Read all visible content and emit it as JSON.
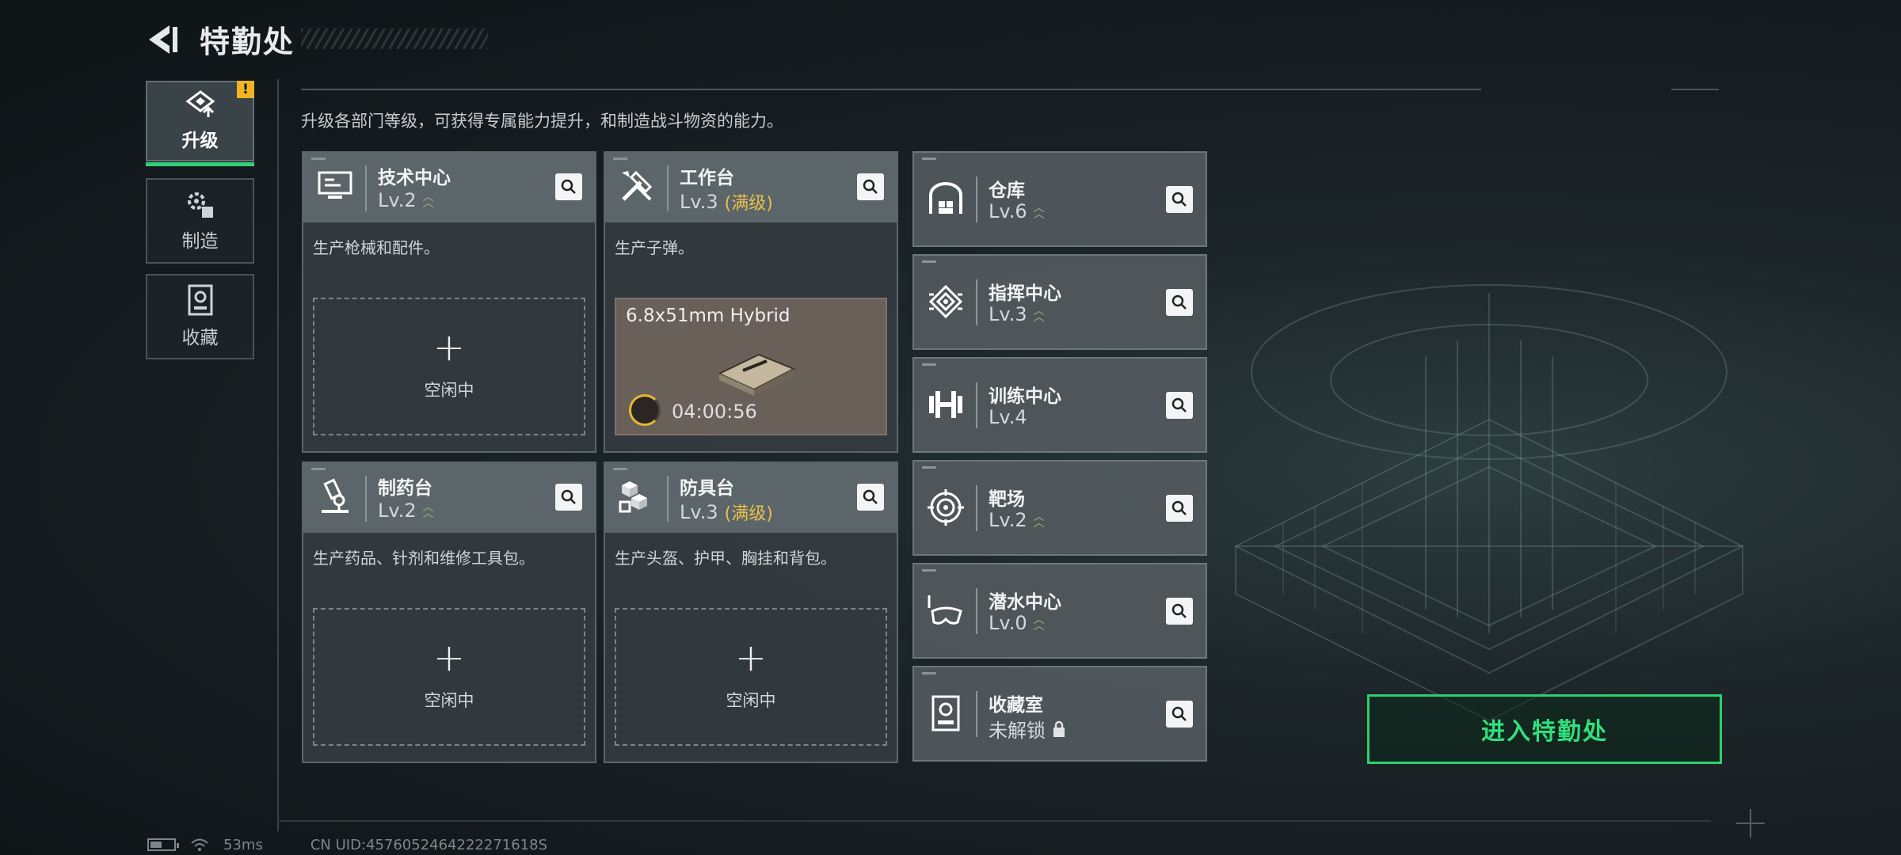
{
  "header": {
    "title": "特勤处"
  },
  "nav": {
    "upgrade_label": "升级",
    "upgrade_badge": "!",
    "craft_label": "制造",
    "collection_label": "收藏"
  },
  "subtitle": "升级各部门等级，可获得专属能力提升，和制造战斗物资的能力。",
  "cards": {
    "tech": {
      "name": "技术中心",
      "level": "Lv.2",
      "desc": "生产枪械和配件。",
      "slot_plus": "+",
      "slot_text": "空闲中"
    },
    "workbench": {
      "name": "工作台",
      "level": "Lv.3",
      "max": "(满级)",
      "desc": "生产子弹。",
      "item_name": "6.8x51mm Hybrid",
      "timer": "04:00:56"
    },
    "pharmacy": {
      "name": "制药台",
      "level": "Lv.2",
      "desc": "生产药品、针剂和维修工具包。",
      "slot_plus": "+",
      "slot_text": "空闲中"
    },
    "armor": {
      "name": "防具台",
      "level": "Lv.3",
      "max": "(满级)",
      "desc": "生产头盔、护甲、胸挂和背包。",
      "slot_plus": "+",
      "slot_text": "空闲中"
    }
  },
  "right_cards": [
    {
      "name": "仓库",
      "level": "Lv.6"
    },
    {
      "name": "指挥中心",
      "level": "Lv.3"
    },
    {
      "name": "训练中心",
      "level": "Lv.4"
    },
    {
      "name": "靶场",
      "level": "Lv.2"
    },
    {
      "name": "潜水中心",
      "level": "Lv.0"
    },
    {
      "name": "收藏室",
      "level": "未解锁"
    }
  ],
  "enter_button": "进入特勤处",
  "status": {
    "ping": "53ms",
    "uid": "CN UID:4576052464222271618S"
  },
  "colors": {
    "accent_green": "#2ad16e",
    "max_gold": "#e8c14a",
    "warn_yellow": "#f0b323"
  }
}
